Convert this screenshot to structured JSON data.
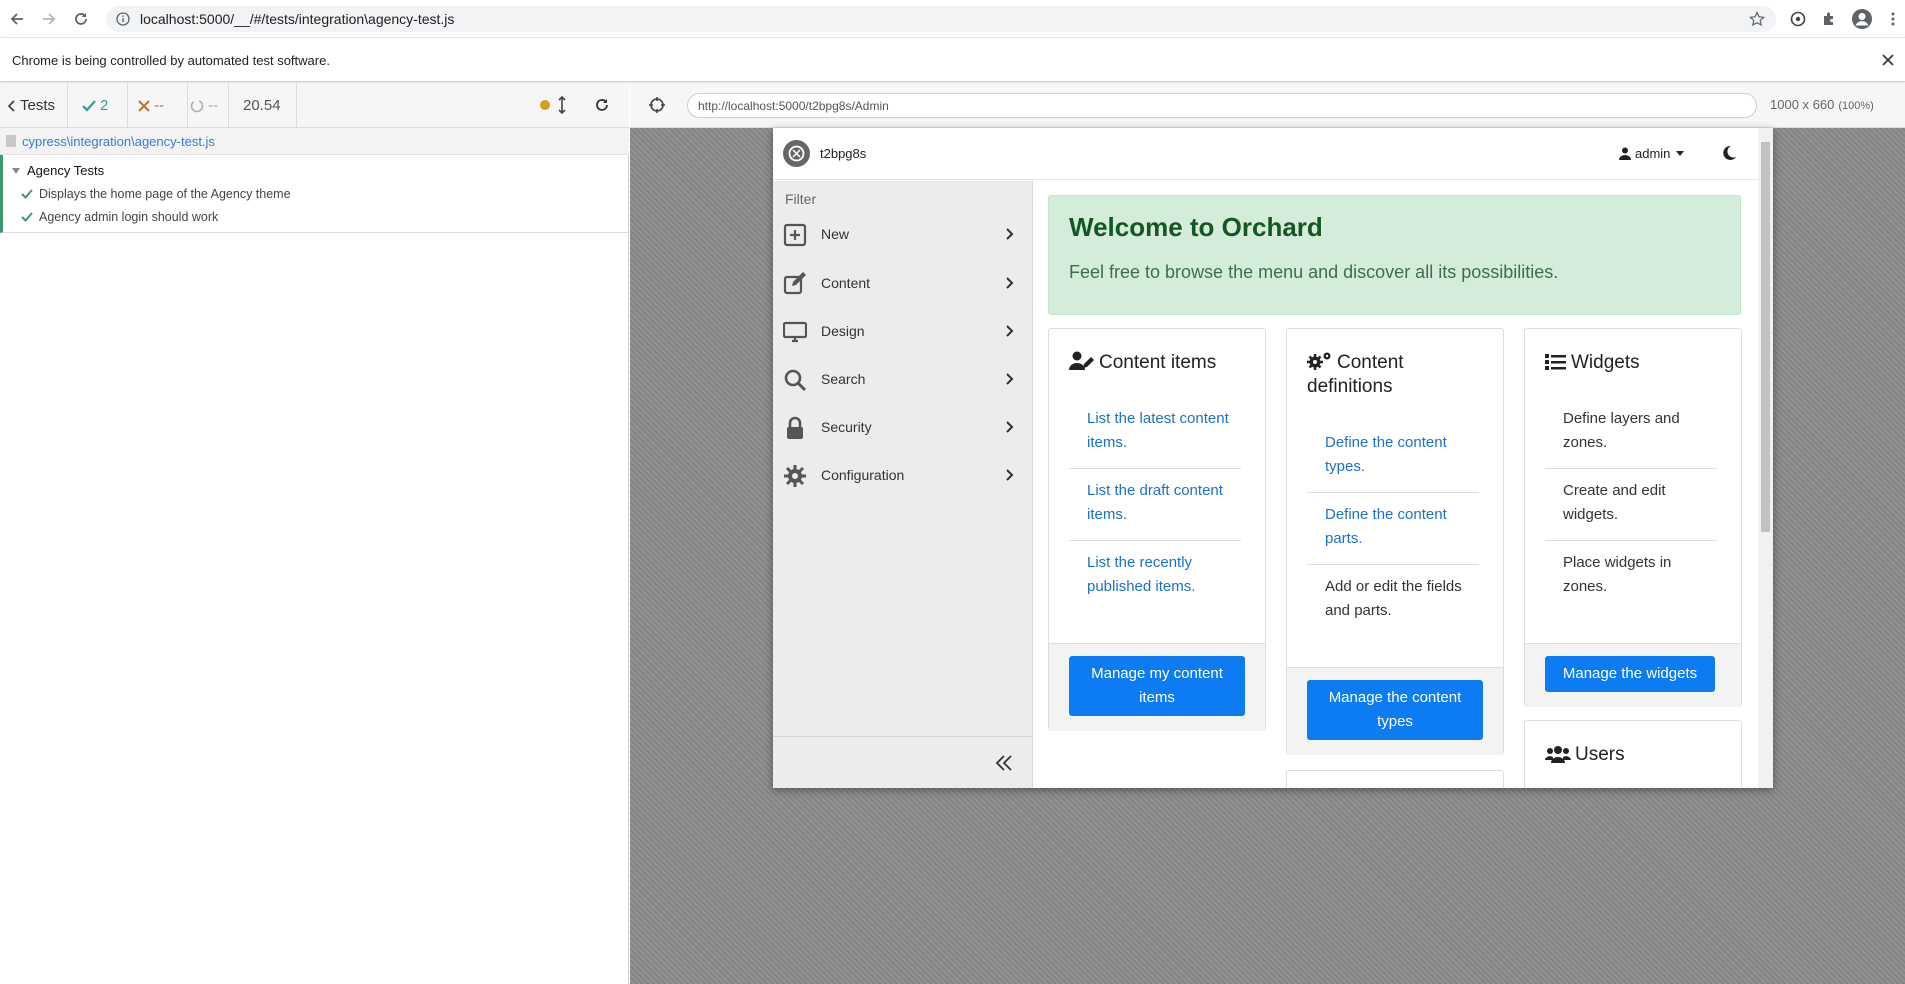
{
  "browser": {
    "url": "localhost:5000/__/#/tests/integration\\agency-test.js",
    "infobar_text": "Chrome is being controlled by automated test software."
  },
  "runner": {
    "back_label": "Tests",
    "passed_count": "2",
    "failed_count": "--",
    "pending_count": "--",
    "duration": "20.54",
    "spec_path": "cypress\\integration\\agency-test.js",
    "suite_title": "Agency Tests",
    "tests": [
      {
        "title": "Displays the home page of the Agency theme"
      },
      {
        "title": "Agency admin login should work"
      }
    ]
  },
  "aut": {
    "url": "http://localhost:5000/t2bpg8s/Admin",
    "viewport": "1000 x 660",
    "zoom": "(100%)"
  },
  "orchard": {
    "site_name": "t2bpg8s",
    "user_name": "admin",
    "filter_placeholder": "Filter",
    "menu": [
      {
        "label": "New",
        "icon": "plus-square-icon"
      },
      {
        "label": "Content",
        "icon": "edit-icon"
      },
      {
        "label": "Design",
        "icon": "desktop-icon"
      },
      {
        "label": "Search",
        "icon": "search-icon"
      },
      {
        "label": "Security",
        "icon": "lock-icon"
      },
      {
        "label": "Configuration",
        "icon": "cog-icon"
      }
    ],
    "welcome": {
      "title": "Welcome to Orchard",
      "subtitle": "Feel free to browse the menu and discover all its possibilities."
    },
    "cards": {
      "content_items": {
        "title": "Content items",
        "items": [
          "List the latest content items.",
          "List the draft content items.",
          "List the recently published items."
        ],
        "button": "Manage my content items"
      },
      "content_definitions": {
        "title": "Content definitions",
        "items": [
          "Define the content types.",
          "Define the content parts.",
          "Add or edit the fields and parts."
        ],
        "button": "Manage the content types"
      },
      "widgets": {
        "title": "Widgets",
        "items": [
          "Define layers and zones.",
          "Create and edit widgets.",
          "Place widgets in zones."
        ],
        "button": "Manage the widgets"
      },
      "users": {
        "title": "Users"
      }
    }
  },
  "colors": {
    "cypress_pass": "#3d9970",
    "cypress_fail": "#c0712b",
    "orchard_primary": "#0d7bf2",
    "welcome_bg": "#d4edda",
    "welcome_text": "#155724"
  }
}
